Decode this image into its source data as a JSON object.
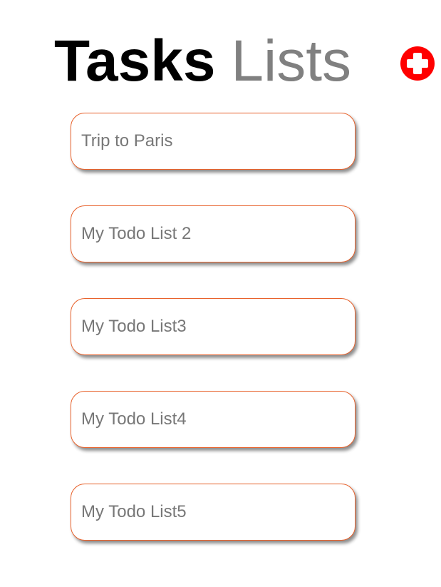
{
  "header": {
    "title_bold": "Tasks",
    "title_light": "Lists"
  },
  "add_button": {
    "icon": "plus-circle-icon",
    "color": "#ff0000"
  },
  "lists": [
    {
      "name": "Trip to Paris"
    },
    {
      "name": "My Todo List 2"
    },
    {
      "name": "My Todo List3"
    },
    {
      "name": "My Todo List4"
    },
    {
      "name": "My Todo List5"
    }
  ],
  "colors": {
    "card_border": "#e8622c",
    "title_primary": "#000000",
    "title_secondary": "#808080",
    "card_text": "#777777"
  }
}
